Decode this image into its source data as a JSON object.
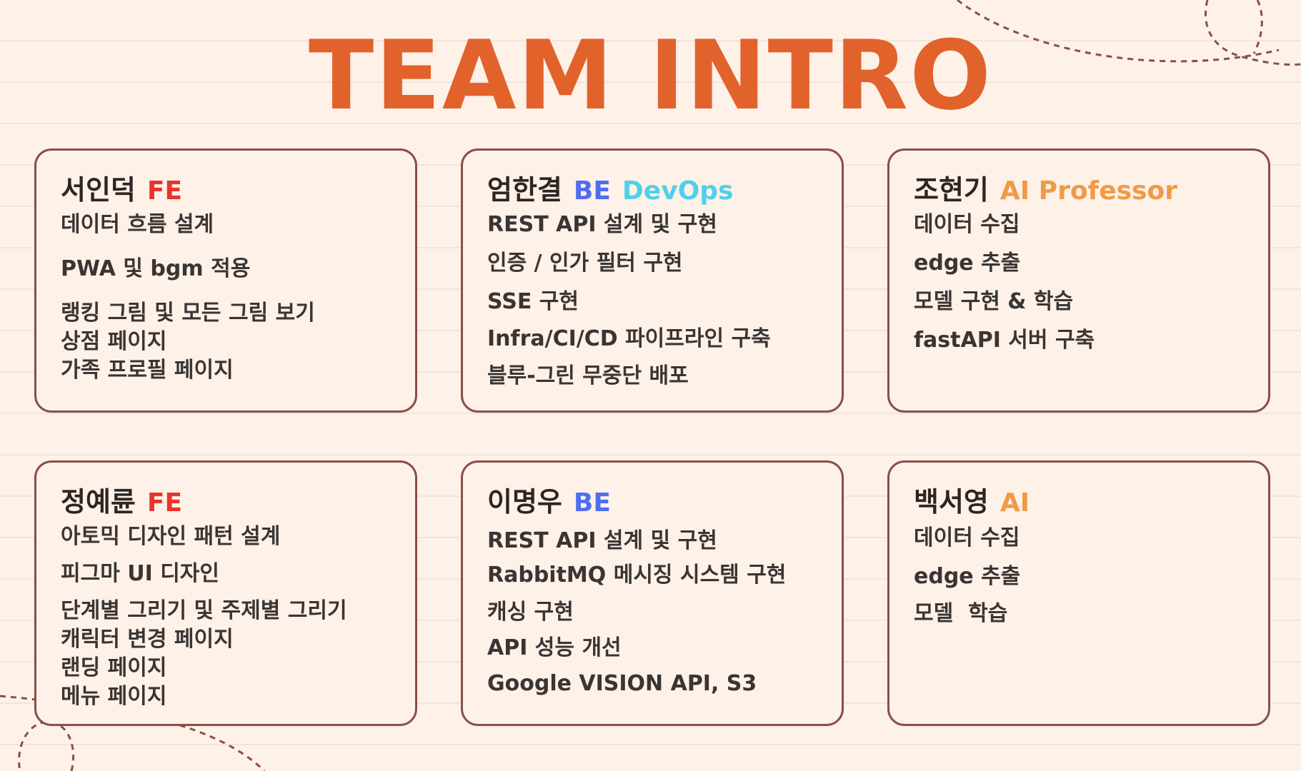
{
  "title": "TEAM INTRO",
  "colors": {
    "background": "#fdf1e8",
    "title": "#e2622c",
    "card_border": "#8a4f45",
    "text": "#3a3533",
    "role_fe": "#e8342c",
    "role_be": "#4f6df0",
    "role_devops": "#4fd0ea",
    "role_ai": "#f09a46"
  },
  "members": [
    {
      "name": "서인덕",
      "roles": [
        {
          "label": "FE",
          "color": "#e8342c"
        }
      ],
      "tasks": [
        "데이터 흐름 설계",
        "PWA 및 bgm 적용",
        "랭킹 그림 및 모든 그림 보기",
        "상점 페이지",
        "가족 프로필 페이지"
      ]
    },
    {
      "name": "엄한결",
      "roles": [
        {
          "label": "BE",
          "color": "#4f6df0"
        },
        {
          "label": "DevOps",
          "color": "#4fd0ea"
        }
      ],
      "tasks": [
        "REST API 설계 및 구현",
        "인증 / 인가 필터 구현",
        "SSE 구현",
        "Infra/CI/CD 파이프라인 구축",
        "블루-그린 무중단 배포"
      ]
    },
    {
      "name": "조현기",
      "roles": [
        {
          "label": "AI Professor",
          "color": "#f09a46"
        }
      ],
      "tasks": [
        "데이터 수집",
        "edge 추출",
        "모델 구현 & 학습",
        "fastAPI 서버 구축"
      ]
    },
    {
      "name": "정예륜",
      "roles": [
        {
          "label": "FE",
          "color": "#e8342c"
        }
      ],
      "tasks": [
        "아토믹 디자인 패턴 설계",
        "피그마 UI 디자인",
        "단계별 그리기 및 주제별 그리기",
        "캐릭터 변경 페이지",
        "랜딩 페이지",
        "메뉴 페이지"
      ]
    },
    {
      "name": "이명우",
      "roles": [
        {
          "label": "BE",
          "color": "#4f6df0"
        }
      ],
      "tasks": [
        "REST API 설계 및 구현",
        "RabbitMQ 메시징 시스템 구현",
        "캐싱 구현",
        "API 성능 개선",
        "Google VISION API, S3"
      ]
    },
    {
      "name": "백서영",
      "roles": [
        {
          "label": "AI",
          "color": "#f09a46"
        }
      ],
      "tasks": [
        "데이터 수집",
        "edge 추출",
        "모델  학습"
      ]
    }
  ]
}
